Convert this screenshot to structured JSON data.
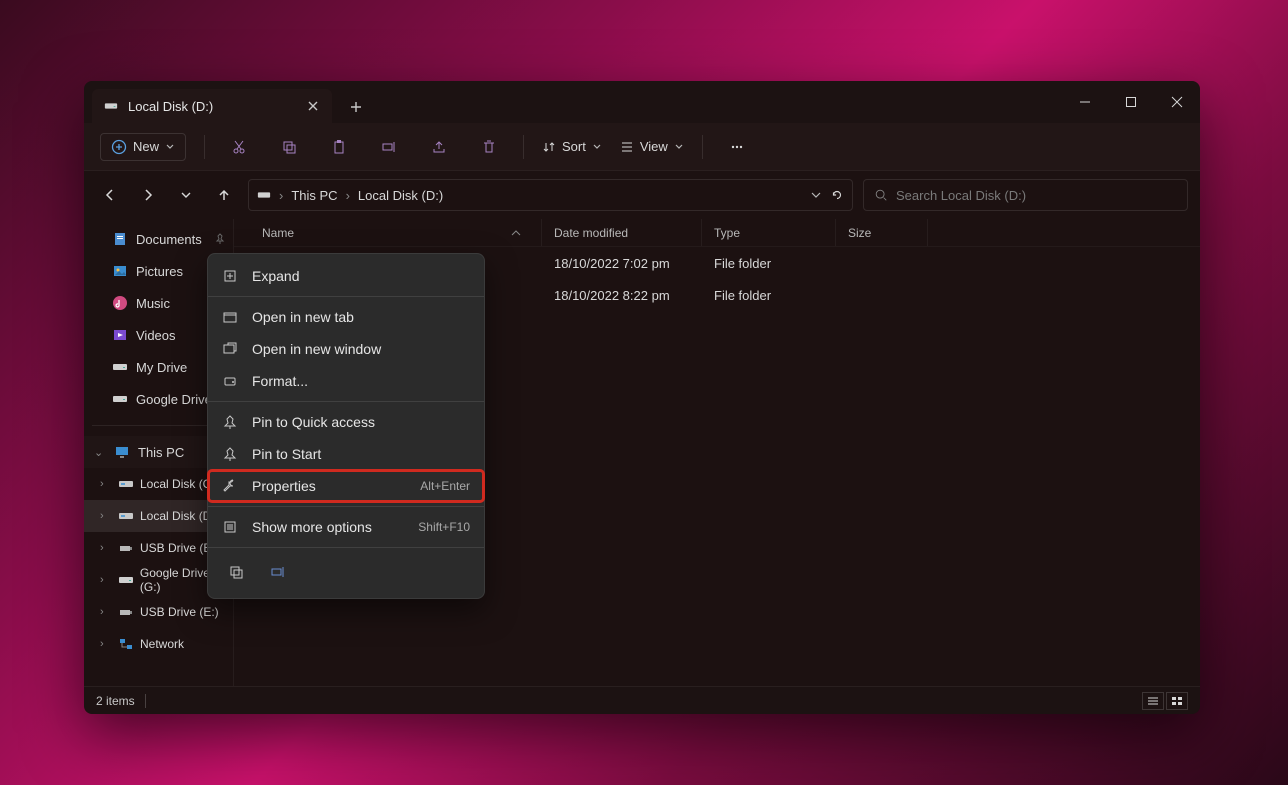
{
  "tab": {
    "title": "Local Disk (D:)"
  },
  "toolbar": {
    "new_label": "New",
    "sort_label": "Sort",
    "view_label": "View"
  },
  "address": {
    "crumb1": "This PC",
    "crumb2": "Local Disk (D:)"
  },
  "search": {
    "placeholder": "Search Local Disk (D:)"
  },
  "sidebar_quick": [
    {
      "label": "Documents",
      "icon": "doc"
    },
    {
      "label": "Pictures",
      "icon": "pic"
    },
    {
      "label": "Music",
      "icon": "music"
    },
    {
      "label": "Videos",
      "icon": "video"
    },
    {
      "label": "My Drive",
      "icon": "drive"
    },
    {
      "label": "Google Drive",
      "icon": "drive"
    }
  ],
  "sidebar_pc_label": "This PC",
  "sidebar_drives": [
    {
      "label": "Local Disk (C:)",
      "icon": "disk"
    },
    {
      "label": "Local Disk (D:)",
      "icon": "disk",
      "selected": true
    },
    {
      "label": "USB Drive (E:)",
      "icon": "usb"
    },
    {
      "label": "Google Drive (G:)",
      "icon": "drive"
    },
    {
      "label": "USB Drive (E:)",
      "icon": "usb"
    },
    {
      "label": "Network",
      "icon": "net"
    }
  ],
  "columns": {
    "name": "Name",
    "date": "Date modified",
    "type": "Type",
    "size": "Size"
  },
  "files": [
    {
      "date": "18/10/2022 7:02 pm",
      "type": "File folder"
    },
    {
      "date": "18/10/2022 8:22 pm",
      "type": "File folder"
    }
  ],
  "status": {
    "count_label": "2 items"
  },
  "context_menu": {
    "expand": "Expand",
    "open_tab": "Open in new tab",
    "open_window": "Open in new window",
    "format": "Format...",
    "pin_quick": "Pin to Quick access",
    "pin_start": "Pin to Start",
    "properties": "Properties",
    "properties_sc": "Alt+Enter",
    "more": "Show more options",
    "more_sc": "Shift+F10"
  }
}
